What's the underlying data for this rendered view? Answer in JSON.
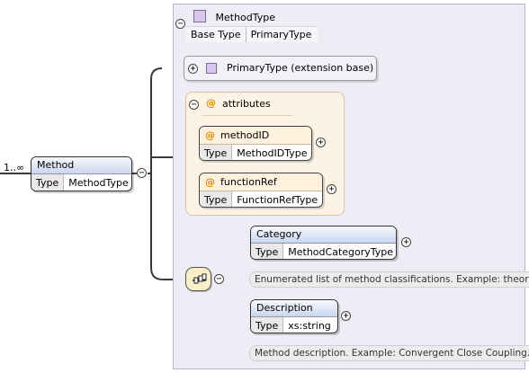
{
  "colors": {
    "header_blue": "#c9d6f0",
    "attr_orange": "#fdf1dd",
    "panel_lavender": "#eeecf4",
    "type_icon": "#d9c8ec"
  },
  "root": {
    "multiplicity": "1..∞",
    "name": "Method",
    "type_key": "Type",
    "type_value": "MethodType"
  },
  "complex_type": {
    "name": "MethodType",
    "icon": "complex-type-icon",
    "base_key": "Base Type",
    "base_value": "PrimaryType"
  },
  "extension": {
    "label": "PrimaryType (extension base)",
    "icon": "complex-type-icon"
  },
  "attributes": {
    "title": "attributes",
    "icon": "at-sign-icon",
    "items": [
      {
        "name": "methodID",
        "type_key": "Type",
        "type_value": "MethodIDType"
      },
      {
        "name": "functionRef",
        "type_key": "Type",
        "type_value": "FunctionRefType"
      }
    ]
  },
  "sequence": {
    "icon": "sequence-compositor-icon"
  },
  "elements": [
    {
      "name": "Category",
      "type_key": "Type",
      "type_value": "MethodCategoryType",
      "annotation": "Enumerated list of method classifications. Example: theory."
    },
    {
      "name": "Description",
      "type_key": "Type",
      "type_value": "xs:string",
      "annotation": "Method description. Example: Convergent Close Coupling."
    }
  ]
}
